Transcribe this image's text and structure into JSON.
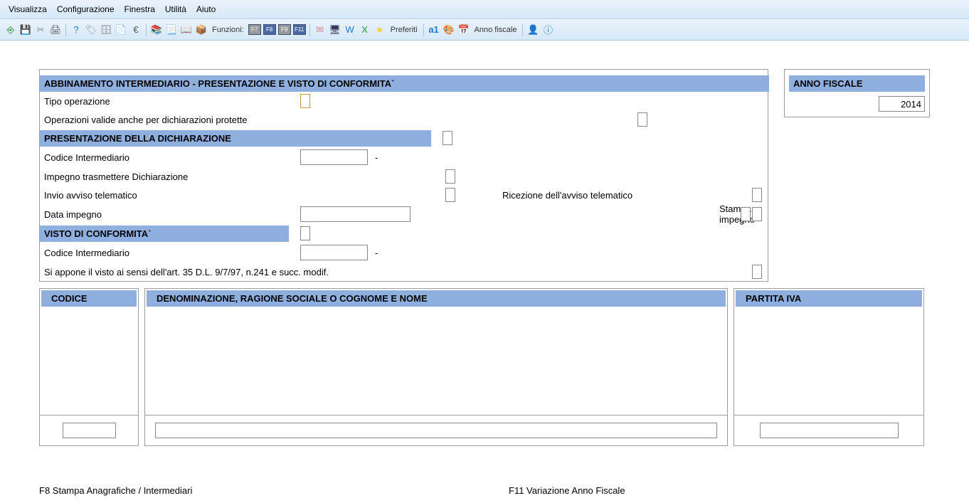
{
  "menu": {
    "visualizza": "Visualizza",
    "configurazione": "Configurazione",
    "finestra": "Finestra",
    "utilita": "Utilità",
    "aiuto": "Aiuto"
  },
  "toolbar": {
    "funzioni": "Funzioni:",
    "f7": "F7",
    "f8": "F8",
    "f9": "F9",
    "f11": "F11",
    "preferiti": "Preferiti",
    "anno_fiscale": "Anno fiscale"
  },
  "headers": {
    "main": "ABBINAMENTO INTERMEDIARIO - PRESENTAZIONE E VISTO DI CONFORMITA`",
    "anno": "ANNO FISCALE",
    "presentazione": "PRESENTAZIONE DELLA DICHIARAZIONE",
    "visto": "VISTO DI CONFORMITA`"
  },
  "labels": {
    "tipo_operazione": "Tipo operazione",
    "op_valide": "Operazioni valide anche per dichiarazioni protette",
    "codice_int": "Codice Intermediario",
    "impegno": "Impegno trasmettere Dichiarazione",
    "invio_avviso": "Invio avviso telematico",
    "ricezione": "Ricezione dell'avviso telematico",
    "data_impegno": "Data impegno",
    "stampa_impegno": "Stampa impegno",
    "visto_text": "Si appone il visto ai sensi dell'art. 35 D.L. 9/7/97, n.241 e succ. modif.",
    "dash": "-"
  },
  "grid": {
    "codice": "CODICE",
    "denom": "DENOMINAZIONE, RAGIONE SOCIALE O COGNOME E NOME",
    "piva": "PARTITA IVA"
  },
  "values": {
    "anno": "2014"
  },
  "hints": {
    "f8": "F8  Stampa Anagrafiche / Intermediari",
    "f11": "F11  Variazione Anno Fiscale"
  }
}
